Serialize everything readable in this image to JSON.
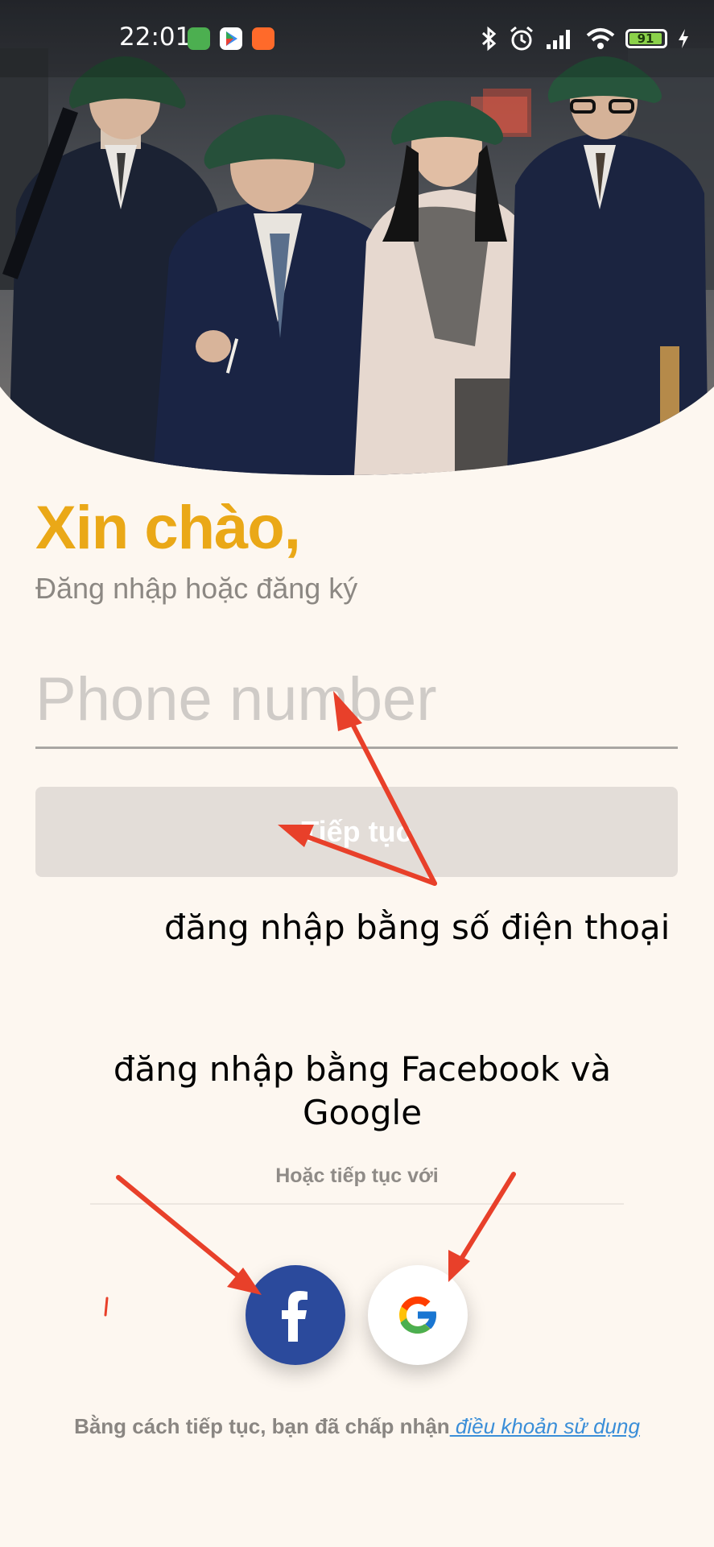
{
  "status_bar": {
    "time": "22:01",
    "battery_level": "91",
    "icons": [
      "app-icon-green",
      "play-store-icon",
      "app-icon-orange",
      "bluetooth-icon",
      "alarm-icon",
      "signal-icon",
      "wifi-icon",
      "battery-icon",
      "charging-icon"
    ]
  },
  "greeting": {
    "title": "Xin chào,",
    "subtitle": "Đăng nhập hoặc đăng ký"
  },
  "phone": {
    "placeholder": "Phone number",
    "value": ""
  },
  "continue_button": {
    "label": "Tiếp tục"
  },
  "annotations": {
    "phone_login": "đăng nhập bằng số điện thoại",
    "social_login": "đăng nhập bằng Facebook và Google"
  },
  "social": {
    "divider_text": "Hoặc tiếp tục với",
    "buttons": [
      {
        "name": "facebook",
        "icon": "facebook-icon"
      },
      {
        "name": "google",
        "icon": "google-icon"
      }
    ]
  },
  "terms": {
    "text": "Bằng cách tiếp tục, bạn đã chấp nhận",
    "link": " điều khoản sử dụng"
  },
  "colors": {
    "background": "#fdf7f0",
    "accent": "#eaa817",
    "facebook": "#2b4a9c",
    "link": "#3a8ed8",
    "annotation_arrow": "#e8402a"
  }
}
